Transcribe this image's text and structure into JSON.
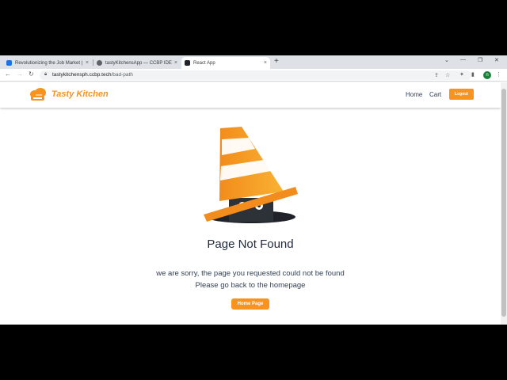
{
  "browser": {
    "tabs": [
      {
        "label": "Revolutionizing the Job Market |",
        "favicon_color": "#1a73e8",
        "active": false
      },
      {
        "label": "tastyKitchensApp — CCBP IDE",
        "favicon_color": "#5f6368",
        "active": false
      },
      {
        "label": "React App",
        "favicon_color": "#20232a",
        "active": true
      }
    ],
    "new_tab_glyph": "+",
    "tab_close_glyph": "×",
    "window_controls": [
      "⌄",
      "—",
      "❐",
      "✕"
    ],
    "url": {
      "domain": "tastykitchensph.ccbp.tech",
      "path": "/bad-path"
    },
    "profile_initial": "n"
  },
  "app": {
    "brand": "Tasty Kitchen",
    "brand_color": "#f7931e",
    "nav": {
      "home": "Home",
      "cart": "Cart"
    },
    "logout_label": "Logout"
  },
  "not_found": {
    "title": "Page Not Found",
    "description_line1": "we are sorry, the page you requested could not be found",
    "description_line2": "Please go back to the homepage",
    "button_label": "Home Page",
    "illustration_icon": "traffic-cone-hole-icon"
  }
}
